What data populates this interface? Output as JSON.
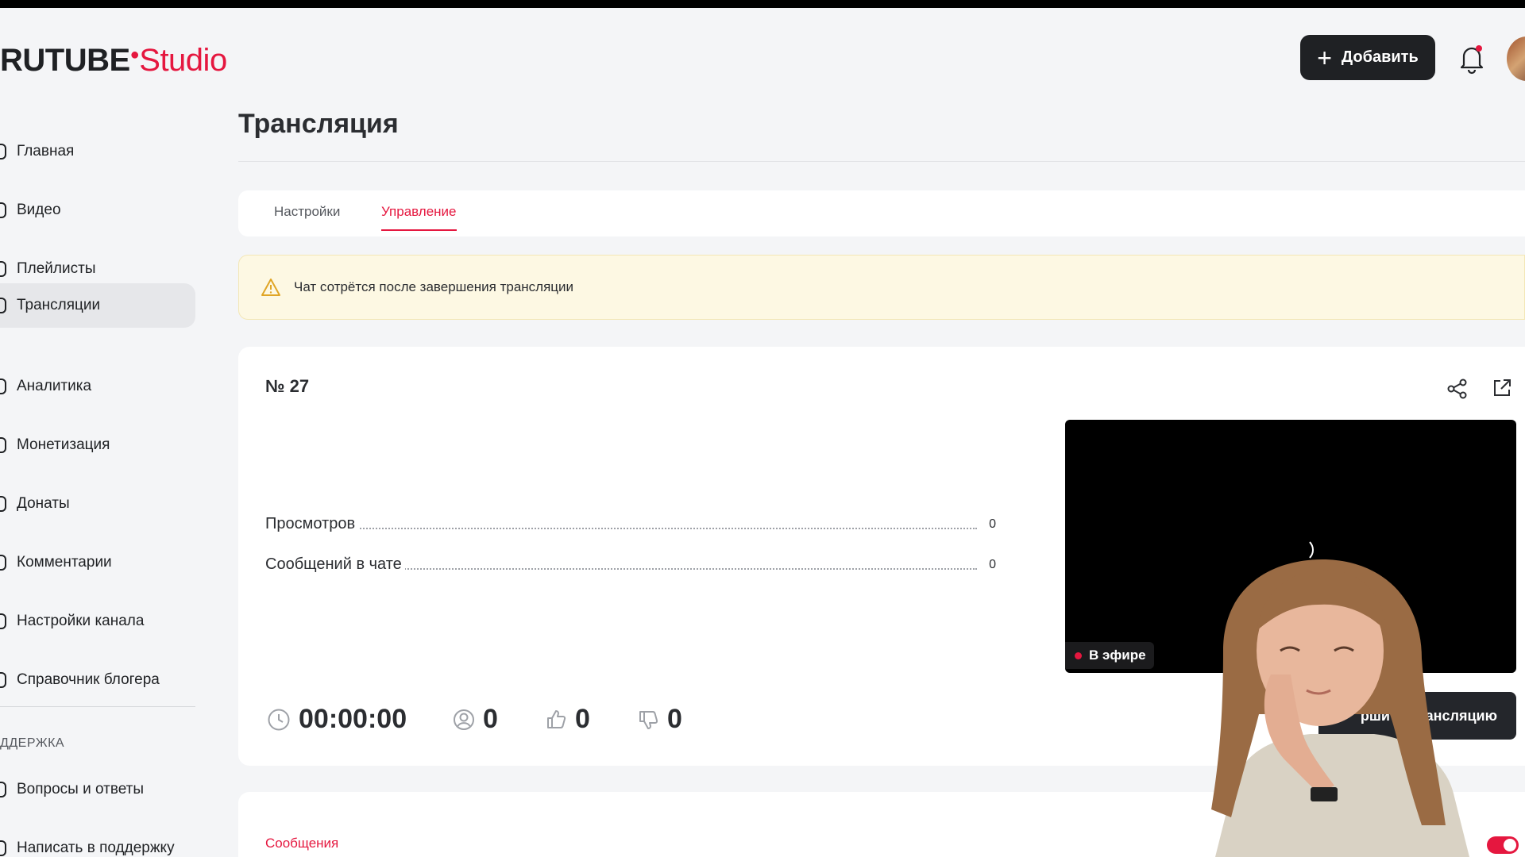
{
  "header": {
    "logo_rutube": "RUTUBE",
    "logo_studio": "Studio",
    "add_button_label": "Добавить",
    "icons": [
      "plus-icon",
      "bell-icon",
      "avatar"
    ]
  },
  "sidebar": {
    "items": [
      {
        "label": "Главная",
        "icon": "home-icon"
      },
      {
        "label": "Видео",
        "icon": "video-icon"
      },
      {
        "label": "Плейлисты",
        "icon": "playlist-icon"
      },
      {
        "label": "Трансляции",
        "icon": "broadcast-icon",
        "active": true
      },
      {
        "label": "Аналитика",
        "icon": "analytics-icon"
      },
      {
        "label": "Монетизация",
        "icon": "money-icon"
      },
      {
        "label": "Донаты",
        "icon": "donate-icon"
      },
      {
        "label": "Комментарии",
        "icon": "comment-icon"
      },
      {
        "label": "Настройки канала",
        "icon": "settings-icon"
      },
      {
        "label": "Справочник блогера",
        "icon": "help-icon"
      }
    ],
    "support_section_label": "ДДЕРЖКА",
    "support_items": [
      {
        "label": "Вопросы и ответы",
        "icon": "faq-icon"
      },
      {
        "label": "Написать в поддержку",
        "icon": "support-icon"
      }
    ]
  },
  "main": {
    "page_title": "Трансляция",
    "tabs": [
      {
        "label": "Настройки"
      },
      {
        "label": "Управление",
        "active": true
      }
    ],
    "alert_text": "Чат сотрётся после завершения трансляции",
    "stream": {
      "number": "№ 27",
      "stats": [
        {
          "name": "Просмотров",
          "value": "0"
        },
        {
          "name": "Сообщений в чате",
          "value": "0"
        }
      ],
      "live_badge": "В эфире",
      "duration": "00:00:00",
      "viewers": "0",
      "likes": "0",
      "dislikes": "0",
      "end_button_label": "ршить трансляцию"
    },
    "messages_tab_label": "Сообщения"
  },
  "colors": {
    "accent": "#e5173f",
    "dark_button": "#1f2124",
    "alert_bg": "#fdf8e3"
  }
}
